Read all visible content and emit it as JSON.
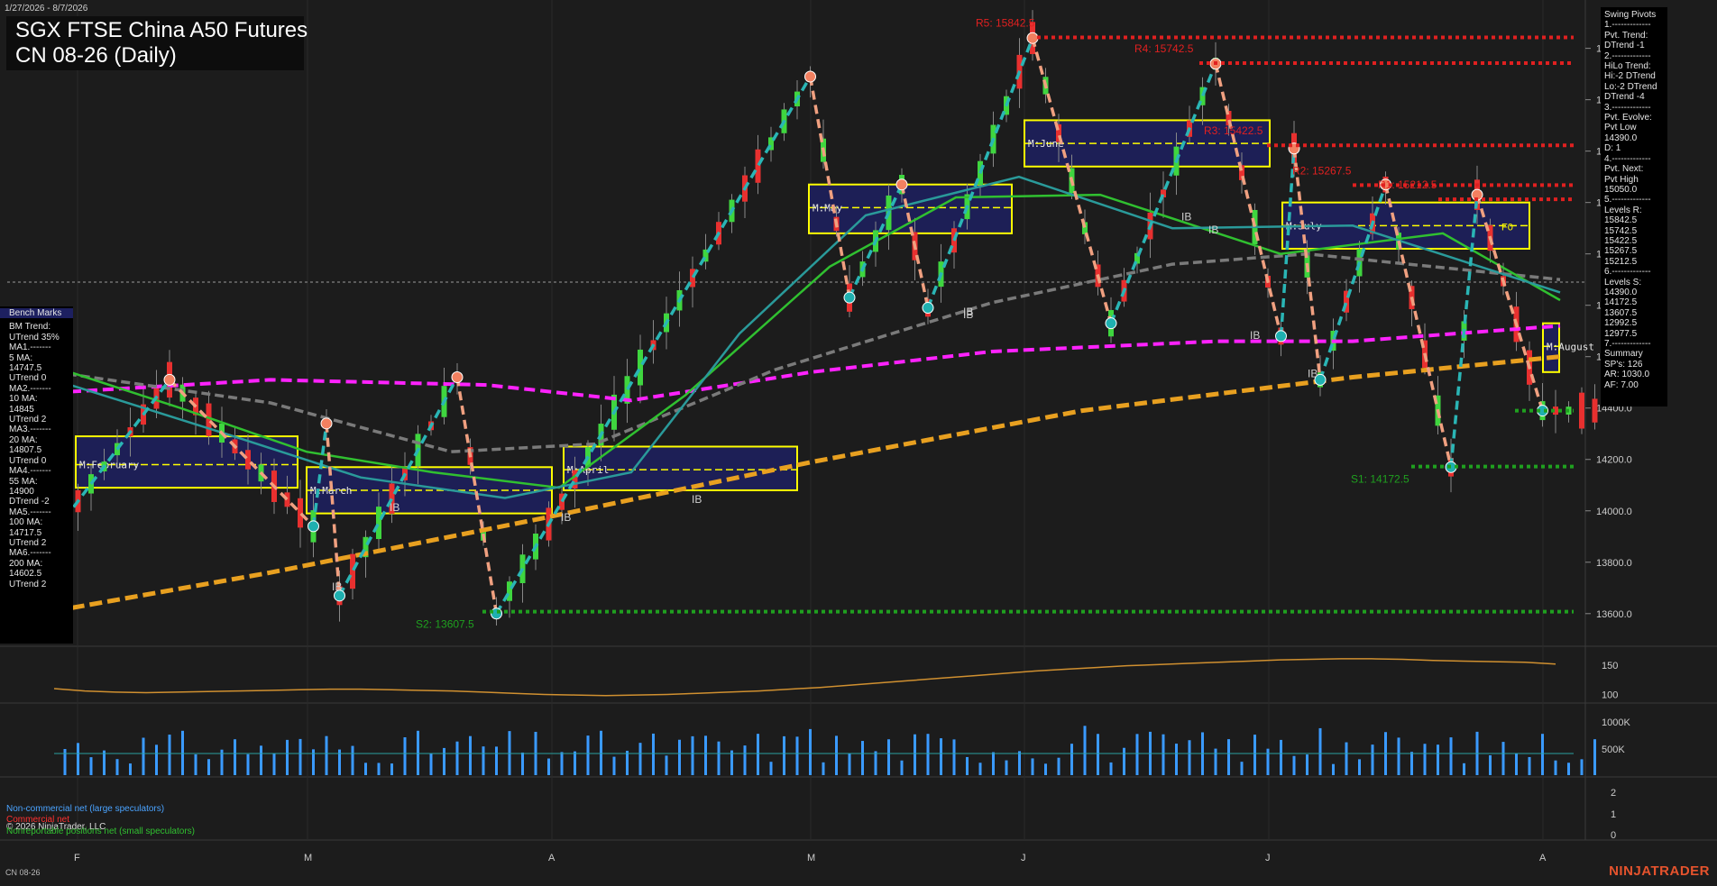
{
  "header": {
    "date_range": "1/27/2026 - 8/7/2026",
    "title_line1": "SGX FTSE China A50 Futures",
    "title_line2": "CN 08-26 (Daily)"
  },
  "colors": {
    "background": "#1c1c1c",
    "up_candle": "#3fd63f",
    "down_candle": "#e8302f",
    "swing_high_line": "#f0a080",
    "swing_low_line": "#2ab5b5",
    "resistance": "#e02020",
    "support": "#1fa01f",
    "ma_magenta": "#ff22ff",
    "ma_orange": "#e8a020",
    "ma_gray": "#7a7a7a",
    "ma_green": "#30c030",
    "ma_teal": "#2a9a9a",
    "box_fill": "#1d2060",
    "box_border": "#ffff00",
    "brand": "#e5532d"
  },
  "swing_pivots_panel": {
    "lines": [
      "Swing Pivots",
      "1.-------------",
      "Pvt. Trend:",
      "DTrend -1",
      "2.-------------",
      "HiLo Trend:",
      "Hi:-2 DTrend",
      "Lo:-2 DTrend",
      "DTrend -4",
      "3.-------------",
      "Pvt. Evolve:",
      "Pvt Low",
      "14390.0",
      "D: 1",
      "4.-------------",
      "Pvt. Next:",
      "Pvt High",
      "15050.0",
      "5.-------------",
      "Levels R:",
      "15842.5",
      "15742.5",
      "15422.5",
      "15267.5",
      "15212.5",
      "6.-------------",
      "Levels S:",
      "14390.0",
      "14172.5",
      "13607.5",
      "12992.5",
      "12977.5",
      "7.-------------",
      "Summary",
      "SP's: 126",
      "AR: 1030.0",
      "AF: 7.00"
    ]
  },
  "benchmarks_panel": {
    "title": "Bench Marks",
    "lines": [
      "BM Trend:",
      "UTrend 35%",
      "MA1.-------",
      "5 MA:",
      "14747.5",
      "UTrend 0",
      "MA2.-------",
      "10 MA:",
      "14845",
      "UTrend 2",
      "MA3.-------",
      "20 MA:",
      "14807.5",
      "UTrend 0",
      "MA4.-------",
      "55 MA:",
      "14900",
      "DTrend -2",
      "MA5.-------",
      "100 MA:",
      "14717.5",
      "UTrend 2",
      "MA6.-------",
      "200 MA:",
      "14602.5",
      "UTrend 2"
    ]
  },
  "levels": [
    {
      "label": "R5: 15842.5",
      "value": 15842.5,
      "kind": "R"
    },
    {
      "label": "R4: 15742.5",
      "value": 15742.5,
      "kind": "R"
    },
    {
      "label": "R3: 15422.5",
      "value": 15422.5,
      "kind": "R"
    },
    {
      "label": "R2: 15267.5",
      "value": 15267.5,
      "kind": "R"
    },
    {
      "label": "R1: 15212.5",
      "value": 15212.5,
      "kind": "R"
    },
    {
      "label": "S1: 14172.5",
      "value": 14172.5,
      "kind": "S"
    },
    {
      "label": "S2: 13607.5",
      "value": 13607.5,
      "kind": "S"
    },
    {
      "label": "",
      "value": 14390.0,
      "kind": "S"
    }
  ],
  "month_boxes": [
    {
      "label": "M:February",
      "hi": 14290,
      "lo": 14090,
      "mid": 14180
    },
    {
      "label": "M:March",
      "hi": 14170,
      "lo": 13990,
      "mid": 14080
    },
    {
      "label": "M:April",
      "hi": 14250,
      "lo": 14080,
      "mid": 14160
    },
    {
      "label": "M:May",
      "hi": 15270,
      "lo": 15080,
      "mid": 15180
    },
    {
      "label": "M:June",
      "hi": 15520,
      "lo": 15340,
      "mid": 15430
    },
    {
      "label": "M:July",
      "hi": 15200,
      "lo": 15020,
      "mid": 15110
    },
    {
      "label": "M:August",
      "hi": 14730,
      "lo": 14540,
      "mid": 14640
    }
  ],
  "ib_labels": [
    "IB",
    "IB",
    "IB",
    "IB",
    "IB",
    "IB",
    "IB",
    "IB",
    "IB",
    "IB"
  ],
  "f0_label": "F0",
  "chart_data": {
    "type": "candlestick",
    "x_axis_labels": [
      "F",
      "M",
      "A",
      "M",
      "J",
      "J",
      "A"
    ],
    "price_axis": {
      "ylim": [
        13480,
        15960
      ],
      "ticks": [
        13600,
        13800,
        14000,
        14200,
        14400,
        14600,
        14800,
        15000,
        15200,
        15400,
        15600,
        15800
      ]
    },
    "current_price_line": 14890,
    "swing_path": [
      [
        0,
        13970
      ],
      [
        8,
        14510
      ],
      [
        19,
        13940
      ],
      [
        20,
        14340
      ],
      [
        21,
        13670
      ],
      [
        30,
        14520
      ],
      [
        33,
        13600
      ],
      [
        57,
        15690
      ],
      [
        60,
        14830
      ],
      [
        64,
        15270
      ],
      [
        66,
        14790
      ],
      [
        74,
        15840
      ],
      [
        80,
        14730
      ],
      [
        88,
        15740
      ],
      [
        93,
        14680
      ],
      [
        94,
        15410
      ],
      [
        96,
        14510
      ],
      [
        101,
        15270
      ],
      [
        106,
        14170
      ],
      [
        108,
        15230
      ],
      [
        113,
        14390
      ]
    ],
    "oscillator_panel": {
      "ticks": [
        100,
        150
      ],
      "values": [
        110,
        106,
        104,
        103,
        104,
        105,
        106,
        107,
        108,
        109,
        109,
        108,
        107,
        106,
        104,
        102,
        100,
        99,
        98,
        99,
        100,
        102,
        104,
        106,
        109,
        112,
        116,
        120,
        124,
        128,
        132,
        136,
        140,
        143,
        146,
        149,
        151,
        153,
        155,
        157,
        159,
        160,
        161,
        161,
        160,
        158,
        157,
        156,
        155,
        152
      ]
    },
    "volume_panel": {
      "ticks": [
        "500K",
        "1000K"
      ]
    },
    "cot_panel": {
      "ticks": [
        0,
        1,
        2
      ],
      "legend": [
        {
          "label": "Non-commercial net (large speculators)",
          "color": "#4aa3ff"
        },
        {
          "label": "Commercial net",
          "color": "#ff3030"
        },
        {
          "label": "Nonreportable positions net (small speculators)",
          "color": "#30c030"
        }
      ]
    }
  },
  "footer": {
    "symbol": "CN 08-26",
    "copyright": "© 2026 NinjaTrader, LLC",
    "brand": "NINJATRADER"
  }
}
